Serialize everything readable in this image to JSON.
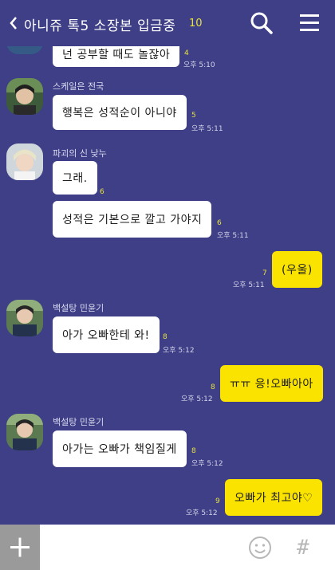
{
  "header": {
    "back_glyph": "《",
    "title": "아니쥬 톡5 소장본 입금중",
    "member_count": "10"
  },
  "messages": [
    {
      "sender": "",
      "text": "넌 공부할 때도 놀잖아",
      "unread": "4",
      "time": "오후 5:10"
    },
    {
      "sender": "스케일은 전국",
      "text": "행복은 성적순이 아니야",
      "unread": "5",
      "time": "오후 5:11"
    },
    {
      "sender": "파괴의 신 낮누",
      "text": "그래.",
      "unread": "6",
      "time": ""
    },
    {
      "sender": "",
      "text": "성적은 기본으로 깔고 가야지",
      "unread": "6",
      "time": "오후 5:11"
    },
    {
      "sender": "",
      "text": "(우울)",
      "unread": "7",
      "time": "오후 5:11"
    },
    {
      "sender": "백설탕 민윤기",
      "text": "아가 오빠한테 와!",
      "unread": "8",
      "time": "오후 5:12"
    },
    {
      "sender": "",
      "text": "ㅠㅠ 응!오빠아아",
      "unread": "8",
      "time": "오후 5:12"
    },
    {
      "sender": "백설탕 민윤기",
      "text": "아가는 오빠가 책임질게",
      "unread": "8",
      "time": "오후 5:12"
    },
    {
      "sender": "",
      "text": "오빠가 최고야♡",
      "unread": "9",
      "time": "오후 5:12"
    }
  ],
  "bottom": {
    "plus_glyph": "+",
    "input_value": "",
    "hash_glyph": "#"
  },
  "colors": {
    "background": "#3e3f87",
    "incoming_bubble": "#ffffff",
    "outgoing_bubble": "#fbe300",
    "unread_count": "#e8e23a"
  },
  "icons": [
    "back-icon",
    "search-icon",
    "menu-icon",
    "plus-icon",
    "emoji-icon",
    "hash-icon"
  ]
}
